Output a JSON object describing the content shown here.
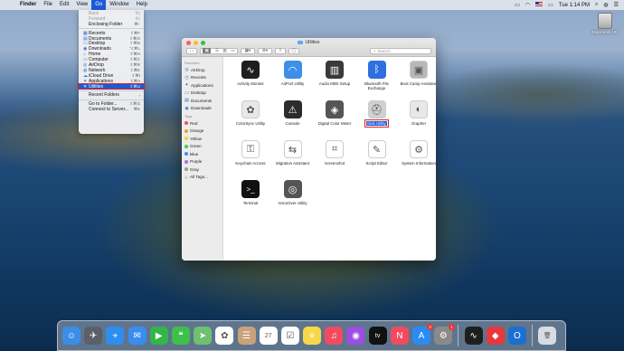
{
  "menubar": {
    "apple_icon": "apple-logo",
    "items": [
      "Finder",
      "File",
      "Edit",
      "View",
      "Go",
      "Window",
      "Help"
    ],
    "clock": "Tue 1:14 PM"
  },
  "go_menu": {
    "items": [
      {
        "label": "Back",
        "shortcut": "⌘[",
        "icon": "",
        "disabled": true
      },
      {
        "label": "Forward",
        "shortcut": "⌘]",
        "icon": "",
        "disabled": true
      },
      {
        "label": "Enclosing Folder",
        "shortcut": "⌘↑",
        "icon": ""
      },
      {
        "sep": true
      },
      {
        "label": "Recents",
        "shortcut": "⇧⌘F",
        "icon": "▦"
      },
      {
        "label": "Documents",
        "shortcut": "⇧⌘O",
        "icon": "▤"
      },
      {
        "label": "Desktop",
        "shortcut": "⇧⌘D",
        "icon": "▭"
      },
      {
        "label": "Downloads",
        "shortcut": "⌥⌘L",
        "icon": "◉"
      },
      {
        "label": "Home",
        "shortcut": "⇧⌘H",
        "icon": "⌂"
      },
      {
        "label": "Computer",
        "shortcut": "⇧⌘C",
        "icon": "▭"
      },
      {
        "label": "AirDrop",
        "shortcut": "⇧⌘R",
        "icon": "◎"
      },
      {
        "label": "Network",
        "shortcut": "⇧⌘K",
        "icon": "◍"
      },
      {
        "label": "iCloud Drive",
        "shortcut": "⇧⌘I",
        "icon": "☁"
      },
      {
        "label": "Applications",
        "shortcut": "⇧⌘A",
        "icon": "✦"
      },
      {
        "label": "Utilities",
        "shortcut": "⇧⌘U",
        "icon": "✕",
        "selected": true
      },
      {
        "sep": true
      },
      {
        "label": "Recent Folders",
        "shortcut": "›",
        "icon": ""
      },
      {
        "sep": true
      },
      {
        "label": "Go to Folder...",
        "shortcut": "⇧⌘G",
        "icon": ""
      },
      {
        "label": "Connect to Server...",
        "shortcut": "⌘K",
        "icon": ""
      }
    ]
  },
  "window": {
    "title": "Utilities",
    "search_placeholder": "Search",
    "sidebar": {
      "favorites_header": "Favorites",
      "favorites": [
        {
          "label": "AirDrop",
          "icon": "◎"
        },
        {
          "label": "Recents",
          "icon": "◷"
        },
        {
          "label": "Applications",
          "icon": "✦"
        },
        {
          "label": "Desktop",
          "icon": "▭"
        },
        {
          "label": "Documents",
          "icon": "▤"
        },
        {
          "label": "Downloads",
          "icon": "◉"
        }
      ],
      "tags_header": "Tags",
      "tags": [
        {
          "label": "Red",
          "color": "#f0524f"
        },
        {
          "label": "Orange",
          "color": "#f39c2b"
        },
        {
          "label": "Yellow",
          "color": "#f5d13a"
        },
        {
          "label": "Green",
          "color": "#4fc650"
        },
        {
          "label": "Blue",
          "color": "#3b8cf2"
        },
        {
          "label": "Purple",
          "color": "#b46be0"
        },
        {
          "label": "Gray",
          "color": "#9a9a9a"
        },
        {
          "label": "All Tags...",
          "color": "#d6d6d6"
        }
      ]
    },
    "apps": [
      {
        "label": "Activity Monitor",
        "icon": "activity-monitor-icon",
        "bg": "#1e1e1e",
        "glyph": "∿"
      },
      {
        "label": "AirPort Utility",
        "icon": "airport-utility-icon",
        "bg": "#3d8fe8",
        "glyph": "◠"
      },
      {
        "label": "Audio MIDI Setup",
        "icon": "audio-midi-icon",
        "bg": "#3a3a3a",
        "glyph": "▥"
      },
      {
        "label": "Bluetooth File Exchange",
        "icon": "bluetooth-icon",
        "bg": "#2f6fe0",
        "glyph": "ᛒ"
      },
      {
        "label": "Boot Camp Assistant",
        "icon": "boot-camp-icon",
        "bg": "#b8b8b8",
        "glyph": "▣"
      },
      {
        "label": "ColorSync Utility",
        "icon": "colorsync-icon",
        "bg": "#e8e8e8",
        "glyph": "✿"
      },
      {
        "label": "Console",
        "icon": "console-icon",
        "bg": "#2c2c2c",
        "glyph": "⚠"
      },
      {
        "label": "Digital Color Meter",
        "icon": "color-meter-icon",
        "bg": "#555555",
        "glyph": "◈"
      },
      {
        "label": "Disk Utility",
        "icon": "disk-utility-icon",
        "bg": "#d0d0d0",
        "glyph": "⛑",
        "selected": true
      },
      {
        "label": "Grapher",
        "icon": "grapher-icon",
        "bg": "#e8e8e8",
        "glyph": "◐"
      },
      {
        "label": "Keychain Access",
        "icon": "keychain-icon",
        "bg": "#ffffff",
        "glyph": "⚿"
      },
      {
        "label": "Migration Assistant",
        "icon": "migration-icon",
        "bg": "#ffffff",
        "glyph": "⇆"
      },
      {
        "label": "Screenshot",
        "icon": "screenshot-icon",
        "bg": "#ffffff",
        "glyph": "⌗"
      },
      {
        "label": "Script Editor",
        "icon": "script-editor-icon",
        "bg": "#ffffff",
        "glyph": "✎"
      },
      {
        "label": "System Information",
        "icon": "system-info-icon",
        "bg": "#ffffff",
        "glyph": "⚙"
      },
      {
        "label": "Terminal",
        "icon": "terminal-icon",
        "bg": "#111111",
        "glyph": ">_"
      },
      {
        "label": "VoiceOver Utility",
        "icon": "voiceover-icon",
        "bg": "#555555",
        "glyph": "◎"
      }
    ]
  },
  "desktop": {
    "drive_label": "Macintosh HD"
  },
  "dock": {
    "apps": [
      {
        "name": "finder-icon",
        "bg": "#3a8ee8",
        "glyph": "☺"
      },
      {
        "name": "launchpad-icon",
        "bg": "#5a5f6a",
        "glyph": "✈"
      },
      {
        "name": "safari-icon",
        "bg": "#2e8ef0",
        "glyph": "⌖"
      },
      {
        "name": "mail-icon",
        "bg": "#3c8cf0",
        "glyph": "✉"
      },
      {
        "name": "facetime-icon",
        "bg": "#34b44a",
        "glyph": "▶"
      },
      {
        "name": "messages-icon",
        "bg": "#3fc04a",
        "glyph": "❝"
      },
      {
        "name": "maps-icon",
        "bg": "#6fc06f",
        "glyph": "➤"
      },
      {
        "name": "photos-icon",
        "bg": "#ffffff",
        "glyph": "✿"
      },
      {
        "name": "contacts-icon",
        "bg": "#c9a27a",
        "glyph": "☰"
      },
      {
        "name": "calendar-icon",
        "bg": "#ffffff",
        "glyph": "27"
      },
      {
        "name": "reminders-icon",
        "bg": "#ffffff",
        "glyph": "☑"
      },
      {
        "name": "notes-icon",
        "bg": "#f6d84a",
        "glyph": "≡"
      },
      {
        "name": "music-icon",
        "bg": "#f24b5f",
        "glyph": "♫"
      },
      {
        "name": "podcasts-icon",
        "bg": "#9b4ee0",
        "glyph": "◉"
      },
      {
        "name": "tv-icon",
        "bg": "#111111",
        "glyph": "tv"
      },
      {
        "name": "news-icon",
        "bg": "#f24b5f",
        "glyph": "N"
      },
      {
        "name": "app-store-icon",
        "bg": "#2a8cf0",
        "glyph": "A",
        "badge": "3"
      },
      {
        "name": "system-preferences-icon",
        "bg": "#8a8a8a",
        "glyph": "⚙",
        "badge": "1"
      },
      {
        "divider": true
      },
      {
        "name": "activity-monitor-icon",
        "bg": "#1e1e1e",
        "glyph": "∿"
      },
      {
        "name": "anydesk-icon",
        "bg": "#e8383d",
        "glyph": "◆"
      },
      {
        "name": "outlook-icon",
        "bg": "#1a6fd0",
        "glyph": "O"
      },
      {
        "divider": true
      },
      {
        "name": "trash-icon",
        "bg": "#d8dce2",
        "glyph": "🗑"
      }
    ]
  }
}
